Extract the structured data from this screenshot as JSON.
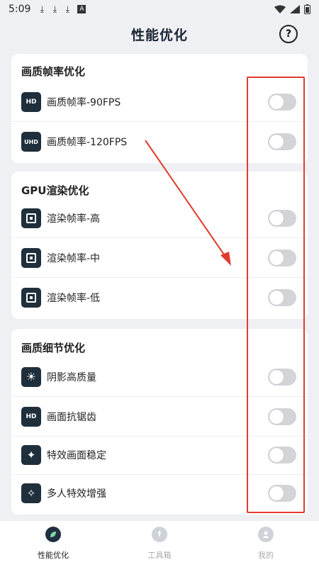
{
  "status_bar": {
    "time": "5:09",
    "icon_a": "A"
  },
  "header": {
    "title": "性能优化",
    "help_label": "?"
  },
  "sections": [
    {
      "title": "画质帧率优化",
      "items": [
        {
          "label": "画质帧率-90FPS",
          "icon_text": "HD",
          "icon": "hd-icon",
          "enabled": false
        },
        {
          "label": "画质帧率-120FPS",
          "icon_text": "UHD",
          "icon": "uhd-icon",
          "enabled": false
        }
      ]
    },
    {
      "title": "GPU渲染优化",
      "items": [
        {
          "label": "渲染帧率-高",
          "icon": "chip-icon",
          "enabled": false
        },
        {
          "label": "渲染帧率-中",
          "icon": "chip-icon",
          "enabled": false
        },
        {
          "label": "渲染帧率-低",
          "icon": "chip-icon",
          "enabled": false
        }
      ]
    },
    {
      "title": "画质细节优化",
      "items": [
        {
          "label": "阴影高质量",
          "icon_glyph": "☀",
          "icon": "sun-icon",
          "enabled": false
        },
        {
          "label": "画面抗锯齿",
          "icon_text": "HD",
          "icon": "hd-icon",
          "enabled": false
        },
        {
          "label": "特效画面稳定",
          "icon_glyph": "✦",
          "icon": "magic-wand-icon",
          "enabled": false
        },
        {
          "label": "多人特效增强",
          "icon_glyph": "✧",
          "icon": "sparkle-wand-icon",
          "enabled": false
        }
      ]
    }
  ],
  "tabs": [
    {
      "label": "性能优化",
      "icon": "leaf-icon",
      "active": true
    },
    {
      "label": "工具箱",
      "icon": "wrench-icon",
      "active": false
    },
    {
      "label": "我的",
      "icon": "user-icon",
      "active": false
    }
  ],
  "colors": {
    "accent": "#1f2f3b",
    "annotation": "#e03b2f",
    "toggle_off": "#d3d4d7"
  }
}
